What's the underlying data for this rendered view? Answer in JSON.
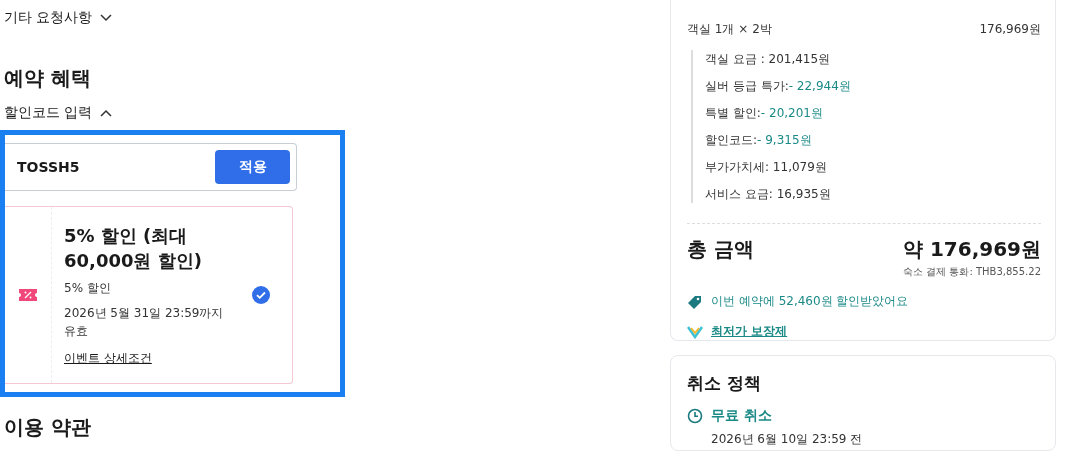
{
  "left": {
    "other_requests": {
      "label": "기타 요청사항",
      "expanded": false
    },
    "benefits_title": "예약 혜택",
    "code_toggle": {
      "label": "할인코드 입력",
      "expanded": true
    },
    "code_field": {
      "value": "TOSSH5"
    },
    "apply_button": "적용",
    "coupon": {
      "title": "5% 할인 (최대 60,000원 할인)",
      "subtitle": "5% 할인",
      "validity": "2026년 5월 31일 23:59까지 유효",
      "link": "이벤트 상세조건",
      "selected": true
    },
    "terms_title": "이용 약관"
  },
  "price": {
    "summary_label": "객실 1개 × 2박",
    "summary_value": "176,969원",
    "items": [
      {
        "label": "객실 요금 : ",
        "amount": "201,415원",
        "kind": "charge"
      },
      {
        "label": "실버 등급 특가:",
        "amount": "- 22,944원",
        "kind": "discount"
      },
      {
        "label": "특별 할인:",
        "amount": "- 20,201원",
        "kind": "discount"
      },
      {
        "label": "할인코드:",
        "amount": "- 9,315원",
        "kind": "discount"
      },
      {
        "label": "부가가치세: ",
        "amount": "11,079원",
        "kind": "charge"
      },
      {
        "label": "서비스 요금: ",
        "amount": "16,935원",
        "kind": "charge"
      }
    ],
    "total_label": "총 금액",
    "total_value": "약 176,969원",
    "currency_note": "숙소 결제 통화: THB3,855.22",
    "savings": "이번 예약에 52,460원 할인받았어요",
    "guarantee_link": "최저가 보장제"
  },
  "cancellation": {
    "title": "취소 정책",
    "free_label": "무료 취소",
    "deadline": "2026년 6월 10일 23:59 전"
  }
}
